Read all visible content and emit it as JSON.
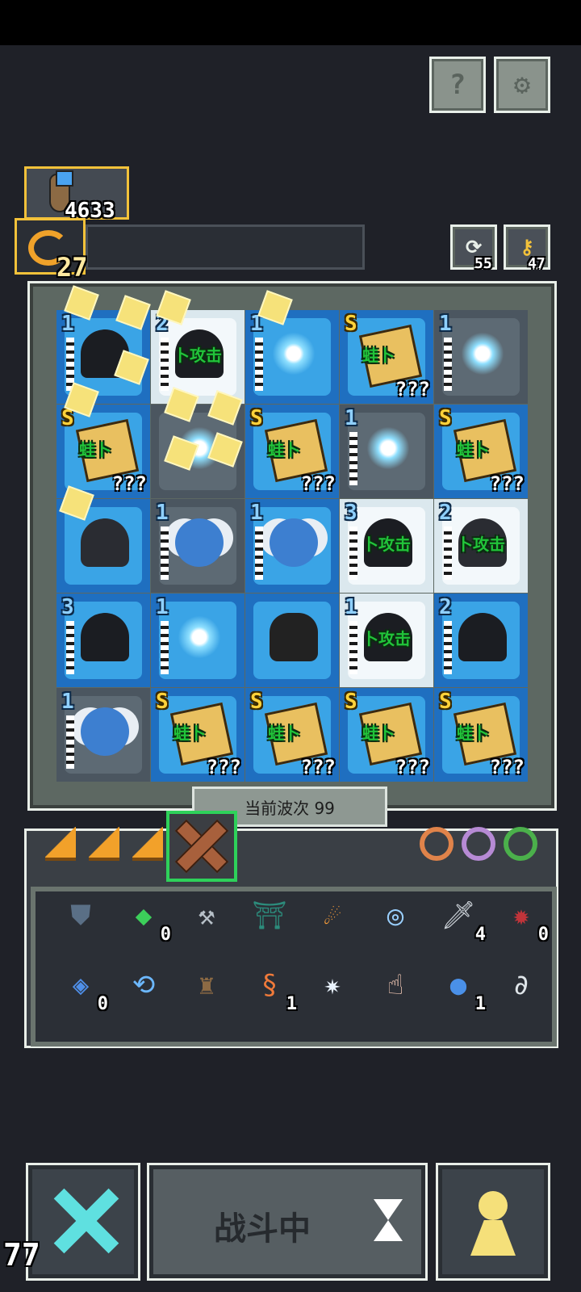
{
  "hud": {
    "currency_value": "4633",
    "level_value": "27",
    "counter_a": "55",
    "counter_b": "47",
    "bottom_left_number": "77"
  },
  "board": {
    "wave_label": "当前波次 99",
    "rows": [
      [
        {
          "level": "1",
          "kind": "ninja",
          "style": "blue"
        },
        {
          "level": "2",
          "kind": "ninja",
          "tag": "卜攻击",
          "style": "light"
        },
        {
          "level": "1",
          "kind": "star",
          "style": "blue"
        },
        {
          "level": "S",
          "kind": "chest",
          "tag": "蛙卜",
          "unknown": "???",
          "style": "blue"
        },
        {
          "level": "1",
          "kind": "star",
          "style": "dark"
        }
      ],
      [
        {
          "level": "S",
          "kind": "chest",
          "tag": "蛙卜",
          "unknown": "???",
          "style": "blue"
        },
        {
          "level": "",
          "kind": "star",
          "style": "dark"
        },
        {
          "level": "S",
          "kind": "chest",
          "tag": "蛙卜",
          "unknown": "???",
          "style": "blue"
        },
        {
          "level": "1",
          "kind": "star",
          "style": "dark"
        },
        {
          "level": "S",
          "kind": "chest",
          "tag": "蛙卜",
          "unknown": "???",
          "style": "blue"
        }
      ],
      [
        {
          "level": "",
          "kind": "bird",
          "style": "blue"
        },
        {
          "level": "1",
          "kind": "angel",
          "style": "dark"
        },
        {
          "level": "1",
          "kind": "angel",
          "style": "blue"
        },
        {
          "level": "3",
          "kind": "ninja",
          "tag": "卜攻击",
          "style": "light"
        },
        {
          "level": "2",
          "kind": "bird",
          "tag": "卜攻击",
          "style": "light"
        }
      ],
      [
        {
          "level": "3",
          "kind": "ninja",
          "style": "blue"
        },
        {
          "level": "1",
          "kind": "star",
          "style": "blue"
        },
        {
          "level": "",
          "kind": "sage",
          "style": "blue"
        },
        {
          "level": "1",
          "kind": "ninja",
          "tag": "卜攻击",
          "style": "light"
        },
        {
          "level": "2",
          "kind": "ninja",
          "style": "blue"
        }
      ],
      [
        {
          "level": "1",
          "kind": "angel",
          "style": "dark"
        },
        {
          "level": "S",
          "kind": "chest",
          "tag": "蛙卜",
          "unknown": "???",
          "style": "blue"
        },
        {
          "level": "S",
          "kind": "chest",
          "tag": "蛙卜",
          "unknown": "???",
          "style": "blue"
        },
        {
          "level": "S",
          "kind": "chest",
          "tag": "蛙卜",
          "unknown": "???",
          "style": "blue"
        },
        {
          "level": "S",
          "kind": "chest",
          "tag": "蛙卜",
          "unknown": "???",
          "style": "blue"
        }
      ]
    ]
  },
  "inventory": {
    "row1": [
      {
        "icon": "shield-icon",
        "count": ""
      },
      {
        "icon": "green-gem-icon",
        "count": "0"
      },
      {
        "icon": "hammer-icon",
        "count": ""
      },
      {
        "icon": "gate-icon",
        "count": ""
      },
      {
        "icon": "fireball-icon",
        "count": ""
      },
      {
        "icon": "vortex-orb-icon",
        "count": ""
      },
      {
        "icon": "sword-icon",
        "count": "4"
      },
      {
        "icon": "claw-icon",
        "count": "0"
      }
    ],
    "row2": [
      {
        "icon": "blue-crystal-icon",
        "count": "0"
      },
      {
        "icon": "cycle-icon",
        "count": ""
      },
      {
        "icon": "potion-bag-icon",
        "count": ""
      },
      {
        "icon": "shrimp-icon",
        "count": "1"
      },
      {
        "icon": "ice-spikes-icon",
        "count": ""
      },
      {
        "icon": "pointing-hand-icon",
        "count": ""
      },
      {
        "icon": "crystal-ball-icon",
        "count": "1"
      },
      {
        "icon": "hook-icon",
        "count": ""
      }
    ]
  },
  "footer": {
    "status_label": "战斗中"
  },
  "colors": {
    "background": "#1f2128",
    "gold": "#f3c23a",
    "tile_blue": "#1f6fc0",
    "tag_green": "#21c43a"
  }
}
